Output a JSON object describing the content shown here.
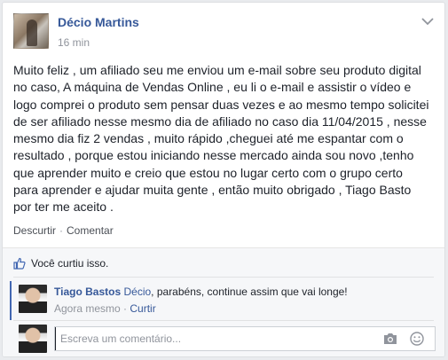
{
  "post": {
    "author": "Décio Martins",
    "time": "16 min",
    "text": "Muito feliz , um afiliado seu me enviou um e-mail sobre seu produto digital\nno caso, A máquina de Vendas Online , eu li o e-mail e assistir o vídeo e\nlogo comprei o produto sem pensar duas vezes e ao mesmo tempo solicitei\nde ser afiliado nesse mesmo dia de afiliado no caso dia 11/04/2015 , nesse\nmesmo dia fiz 2 vendas , muito rápido ,cheguei até me espantar com o\nresultado , porque estou iniciando nesse mercado ainda sou novo ,tenho\nque aprender muito e creio que estou no lugar certo com o grupo certo\npara aprender e ajudar muita gente , então muito obrigado , Tiago Basto\npor ter me aceito .",
    "actions": {
      "unlike": "Descurtir",
      "separator": "·",
      "comment": "Comentar"
    }
  },
  "likes": {
    "text": "Você curtiu isso.",
    "icon": "thumbs-up-icon"
  },
  "comment": {
    "author": "Tiago Bastos",
    "tag": "Décio",
    "text": ", parabéns, continue assim que vai longe!",
    "time": "Agora mesmo",
    "separator": "·",
    "like": "Curtir"
  },
  "composer": {
    "placeholder": "Escreva um comentário...",
    "icons": [
      "camera-icon",
      "smiley-icon"
    ]
  },
  "colors": {
    "link": "#365899",
    "accent": "#4267b2",
    "muted": "#90949c",
    "text": "#1d2129"
  }
}
